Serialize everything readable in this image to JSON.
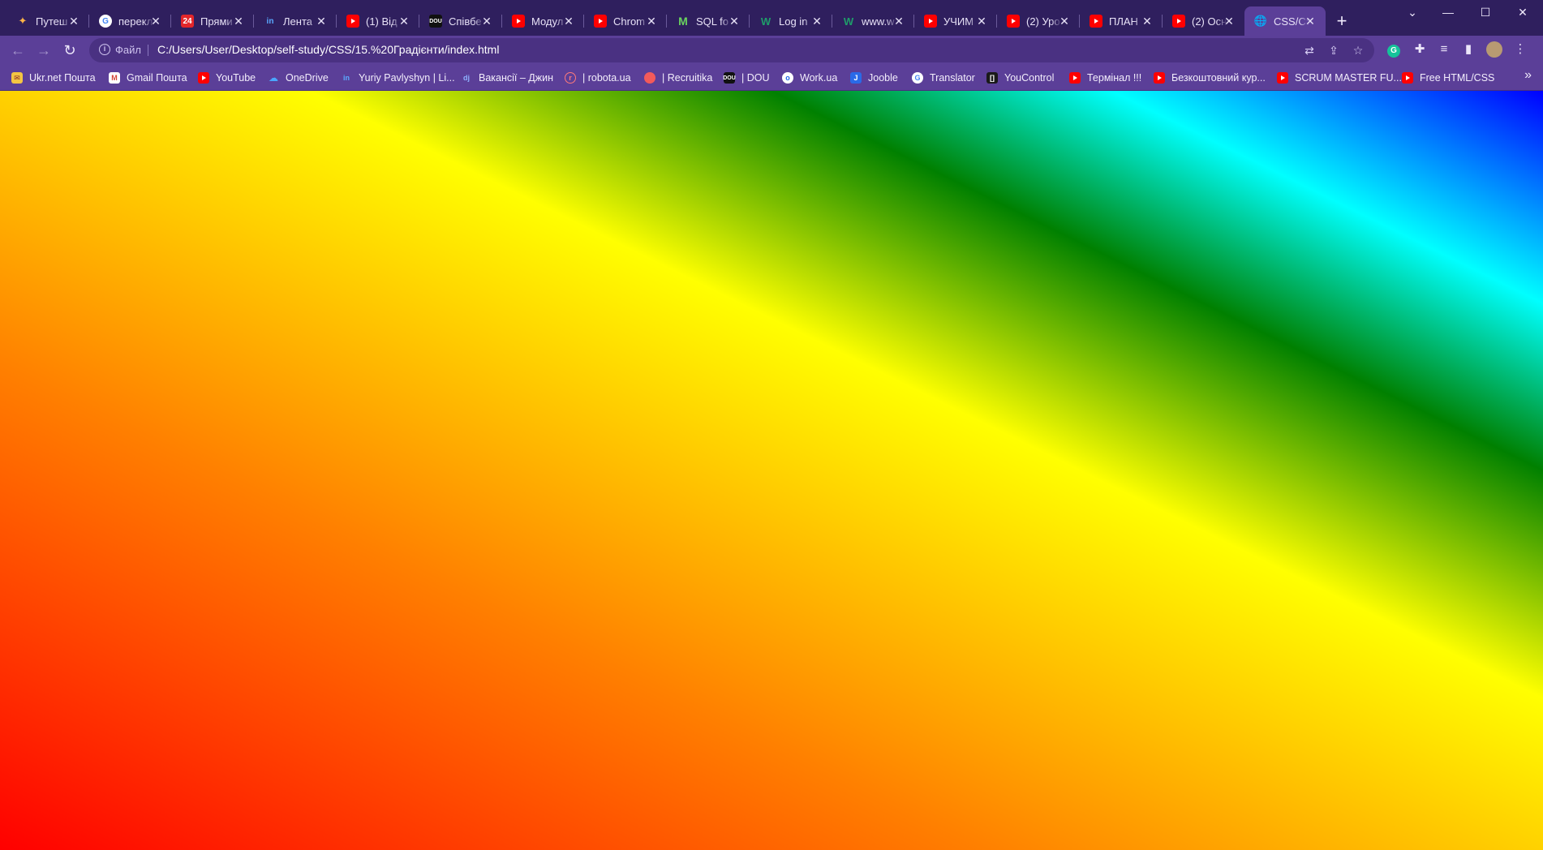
{
  "tabs": [
    {
      "title": "Путеш",
      "icon": "pinwheel-icon"
    },
    {
      "title": "перекл",
      "icon": "google-icon"
    },
    {
      "title": "Прями",
      "icon": "site-24-icon"
    },
    {
      "title": "Лента",
      "icon": "linkedin-icon"
    },
    {
      "title": "(1) Від",
      "icon": "youtube-icon"
    },
    {
      "title": "Співбе",
      "icon": "dou-icon"
    },
    {
      "title": "Модул",
      "icon": "youtube-icon"
    },
    {
      "title": "Chrom",
      "icon": "youtube-icon"
    },
    {
      "title": "SQL fo",
      "icon": "m-logo-icon"
    },
    {
      "title": "Log in",
      "icon": "w-logo-icon"
    },
    {
      "title": "www.w",
      "icon": "w-logo-icon"
    },
    {
      "title": "УЧИМ",
      "icon": "youtube-icon"
    },
    {
      "title": "(2) Уро",
      "icon": "youtube-icon"
    },
    {
      "title": "ПЛАН",
      "icon": "youtube-icon"
    },
    {
      "title": "(2) Осн",
      "icon": "youtube-icon"
    },
    {
      "title": "CSS/CS",
      "icon": "globe-icon",
      "active": true
    }
  ],
  "toolbar": {
    "file_label": "Файл",
    "url": "C:/Users/User/Desktop/self-study/CSS/15.%20Градієнти/index.html"
  },
  "bookmarks": [
    {
      "label": "Ukr.net Пошта",
      "icon": "ukrnet-icon"
    },
    {
      "label": "Gmail Пошта",
      "icon": "gmail-icon"
    },
    {
      "label": "YouTube",
      "icon": "youtube-icon"
    },
    {
      "label": "OneDrive",
      "icon": "onedrive-icon"
    },
    {
      "label": "Yuriy Pavlyshyn | Li...",
      "icon": "linkedin-icon"
    },
    {
      "label": "Вакансії – Джин",
      "icon": "djinni-icon"
    },
    {
      "label": "| robota.ua",
      "icon": "robota-icon"
    },
    {
      "label": "| Recruitika",
      "icon": "recruitika-icon"
    },
    {
      "label": "| DOU",
      "icon": "dou-icon"
    },
    {
      "label": "Work.ua",
      "icon": "workua-icon"
    },
    {
      "label": "Jooble",
      "icon": "jooble-icon"
    },
    {
      "label": "Translator",
      "icon": "google-icon"
    },
    {
      "label": "YouControl",
      "icon": "youcontrol-icon"
    },
    {
      "label": "Термінал !!!",
      "icon": "youtube-icon"
    },
    {
      "label": "Безкоштовний кур...",
      "icon": "youtube-icon"
    },
    {
      "label": "SCRUM MASTER FU...",
      "icon": "youtube-icon"
    },
    {
      "label": "Free HTML/CSS",
      "icon": "youtube-icon"
    }
  ],
  "page": {
    "gradient_colors": [
      "#ff0000",
      "#ff8000",
      "#ffff00",
      "#008000",
      "#00ffff",
      "#0000ff"
    ],
    "gradient_direction": "to top right"
  },
  "colors": {
    "tabstrip": "#2f1f5e",
    "toolbar": "#5b3f98",
    "omnibox": "#4a3182"
  }
}
